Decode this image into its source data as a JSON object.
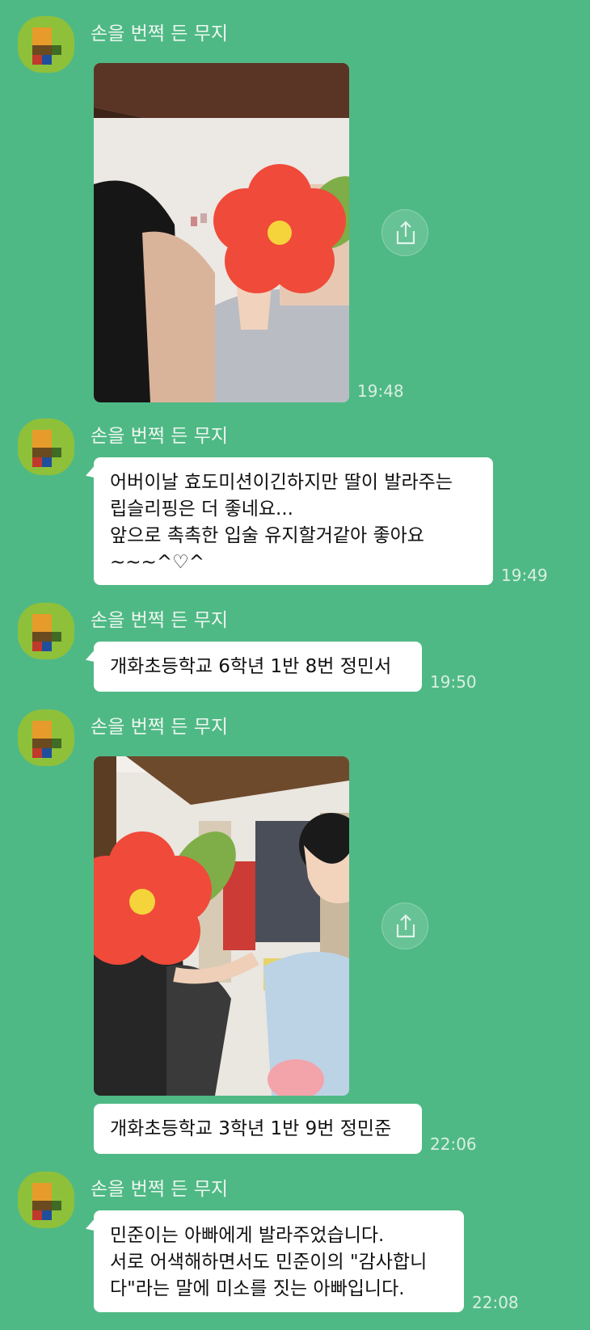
{
  "sender_name": "손을 번쩍 든 무지",
  "messages": [
    {
      "type": "photo",
      "time": "19:48"
    },
    {
      "type": "text",
      "lines": [
        "어버이날 효도미션이긴하지만 딸이 발라주는",
        "립슬리핑은 더 좋네요...",
        "앞으로 촉촉한 입술 유지할거같아 좋아요",
        "~~~^♡^"
      ],
      "time": "19:49"
    },
    {
      "type": "text",
      "lines": [
        "개화초등학교 6학년 1반 8번 정민서"
      ],
      "time": "19:50"
    },
    {
      "type": "photo"
    },
    {
      "type": "text",
      "lines": [
        "개화초등학교 3학년 1반 9번 정민준"
      ],
      "time": "22:06"
    },
    {
      "type": "text",
      "lines": [
        "민준이는 아빠에게 발라주었습니다.",
        "서로 어색해하면서도 민준이의 \"감사합니",
        "다\"라는 말에 미소를 짓는 아빠입니다."
      ],
      "time": "22:08"
    }
  ],
  "icons": {
    "share": "share-icon",
    "sticker": "flower-sticker"
  },
  "colors": {
    "background": "#4fb985",
    "bubble": "#ffffff",
    "avatar": "#8fc03a"
  }
}
